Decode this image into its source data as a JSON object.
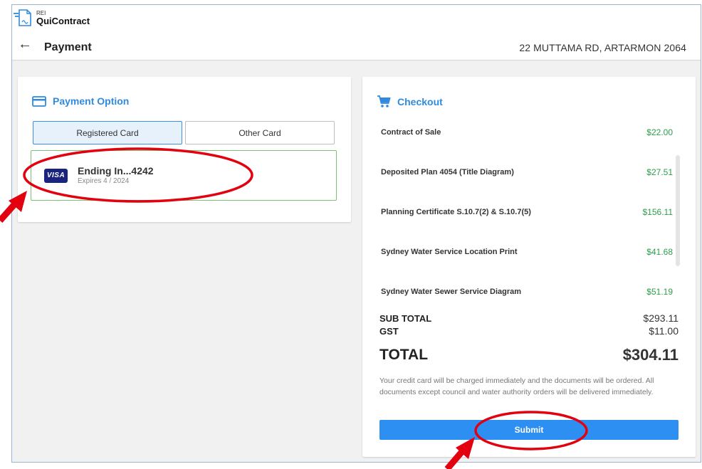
{
  "app": {
    "logo_small": "REI",
    "logo_name": "QuiContract"
  },
  "header": {
    "title": "Payment",
    "address": "22 MUTTAMA RD, ARTARMON 2064"
  },
  "payment_option": {
    "heading": "Payment Option",
    "tabs": [
      {
        "label": "Registered Card",
        "active": true
      },
      {
        "label": "Other Card",
        "active": false
      }
    ],
    "card": {
      "brand": "VISA",
      "ending": "Ending In...4242",
      "expiry": "Expires 4 / 2024"
    }
  },
  "checkout": {
    "heading": "Checkout",
    "items": [
      {
        "name": "Contract of Sale",
        "price": "$22.00"
      },
      {
        "name": "Deposited Plan 4054 (Title Diagram)",
        "price": "$27.51"
      },
      {
        "name": "Planning Certificate S.10.7(2) & S.10.7(5)",
        "price": "$156.11"
      },
      {
        "name": "Sydney Water Service Location Print",
        "price": "$41.68"
      },
      {
        "name": "Sydney Water Sewer Service Diagram",
        "price": "$51.19"
      }
    ],
    "subtotal_label": "SUB TOTAL",
    "subtotal_value": "$293.11",
    "gst_label": "GST",
    "gst_value": "$11.00",
    "total_label": "TOTAL",
    "total_value": "$304.11",
    "note": "Your credit card will be charged immediately and the documents will be ordered. All documents except council and water authority orders will be delivered immediately.",
    "submit_label": "Submit"
  },
  "colors": {
    "accent": "#2f8ae0",
    "button": "#2d8ff2",
    "price_green": "#2e9e4a",
    "card_border": "#79c273",
    "annotation_red": "#e3000f"
  }
}
